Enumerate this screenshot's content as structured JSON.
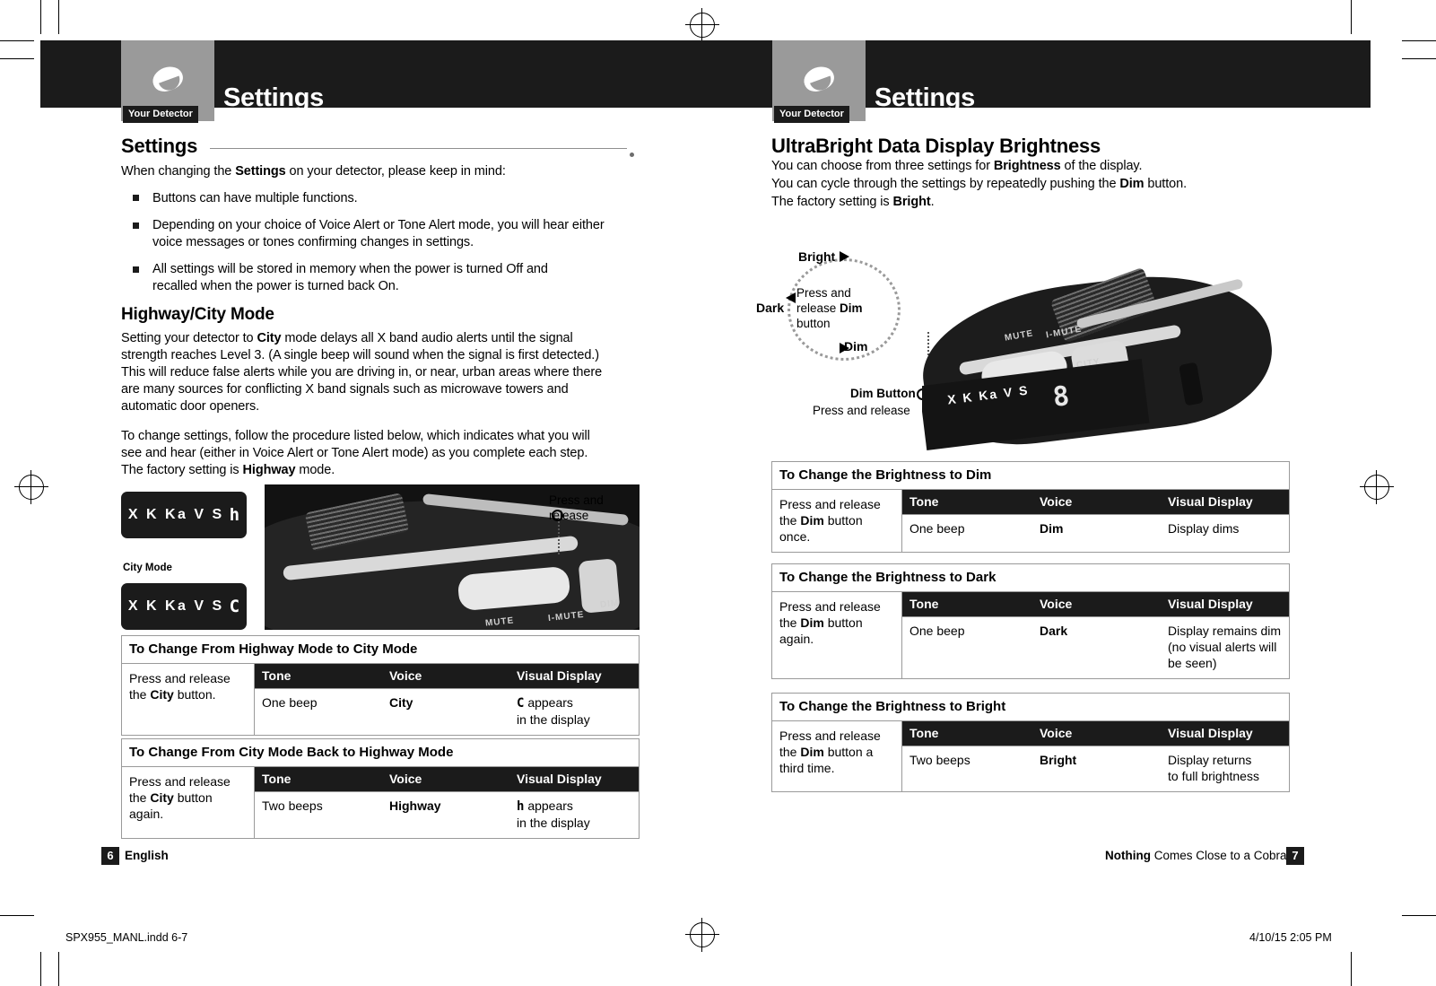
{
  "header": {
    "left_tab_label": "Your Detector",
    "left_title": "Settings",
    "right_tab_label": "Your Detector",
    "right_title": "Settings"
  },
  "left_page": {
    "section_title": "Settings",
    "intro": "When changing the Settings on your detector, please keep in mind:",
    "intro_bold": "Settings",
    "bullets": [
      "Buttons can have multiple functions.",
      "Depending on your choice of Voice Alert or Tone Alert mode, you will hear either voice messages or tones confirming changes in settings.",
      "All settings will be stored in memory when the power is turned Off and recalled when the power is turned back On."
    ],
    "subsection_title": "Highway/City Mode",
    "para1": "Setting your detector to City mode delays all X band audio alerts until the signal strength reaches Level 3. (A single beep will sound when the signal is first detected.) This will reduce false alerts while you are driving in, or near, urban areas where there are many sources for conflicting X band signals such as microwave towers and automatic door openers.",
    "para2": "To change settings, follow the procedure listed below, which indicates what you will see and hear (either in Voice Alert or Tone Alert mode) as you complete each step. The factory setting is Highway mode.",
    "lcd_top": {
      "bands": "X K Ka V S",
      "segment": "h"
    },
    "lcd_bottom": {
      "bands": "X K Ka V S",
      "segment": "C"
    },
    "city_mode_caption": "City Mode",
    "photo_callout": "Press and release",
    "photo_labels": [
      "MUTE",
      "I-MUTE",
      "DIM"
    ],
    "tables": [
      {
        "title": "To Change From Highway Mode to City Mode",
        "action": "Press and release the City button.",
        "action_bold": "City",
        "headers": [
          "Tone",
          "Voice",
          "Visual Display"
        ],
        "row": [
          "One beep",
          "City",
          "C appears in the display"
        ],
        "row_segment": "C"
      },
      {
        "title": "To Change From City Mode Back to Highway Mode",
        "action": "Press and release the City button again.",
        "action_bold": "City",
        "headers": [
          "Tone",
          "Voice",
          "Visual Display"
        ],
        "row": [
          "Two beeps",
          "Highway",
          "h appears in the display"
        ],
        "row_segment": "h"
      }
    ],
    "page_number": "6",
    "footer_label": "English"
  },
  "right_page": {
    "section_title": "UltraBright Data Display Brightness",
    "para_lines": [
      "You can choose from three settings for Brightness of the display.",
      "You can cycle through the settings by repeatedly pushing the Dim button.",
      "The factory setting is Bright."
    ],
    "cycle": {
      "bright_label": "Bright",
      "dark_label": "Dark",
      "dim_label": "Dim",
      "note": "Press and release Dim button",
      "note_bold": "Dim"
    },
    "dim_button_callout": "Dim Button",
    "dim_button_sub": "Press and release",
    "photo_labels": [
      "MUTE",
      "I-MUTE",
      "CITY"
    ],
    "lcd_bands": "X K Ka V S",
    "lcd_digit": "8",
    "tables": [
      {
        "title": "To Change the Brightness to Dim",
        "action": "Press and release the Dim button once.",
        "action_bold": "Dim",
        "headers": [
          "Tone",
          "Voice",
          "Visual Display"
        ],
        "row": [
          "One beep",
          "Dim",
          "Display dims"
        ]
      },
      {
        "title": "To Change the Brightness to Dark",
        "action": "Press and release the Dim button again.",
        "action_bold": "Dim",
        "headers": [
          "Tone",
          "Voice",
          "Visual Display"
        ],
        "row": [
          "One beep",
          "Dark",
          "Display remains dim (no visual alerts will be seen)"
        ]
      },
      {
        "title": "To Change the Brightness to Bright",
        "action": "Press and release the Dim button a third time.",
        "action_bold": "Dim",
        "headers": [
          "Tone",
          "Voice",
          "Visual Display"
        ],
        "row": [
          "Two beeps",
          "Bright",
          "Display returns to full brightness"
        ]
      }
    ],
    "page_number": "7",
    "footer_tagline_bold": "Nothing",
    "footer_tagline_rest": " Comes Close to a Cobra®"
  },
  "bottom_meta": {
    "file": "SPX955_MANL.indd   6-7",
    "date": "4/10/15   2:05 PM"
  }
}
